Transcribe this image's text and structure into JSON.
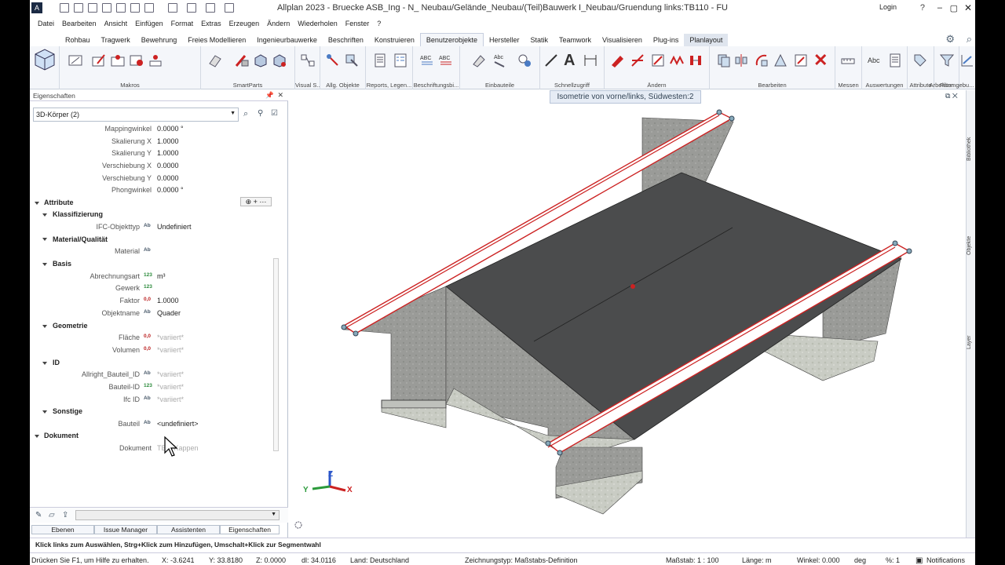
{
  "window": {
    "title": "Allplan 2023 - Bruecke ASB_Ing - N_ Neubau/Gelände_Neubau/(Teil)Bauwerk I_Neubau/Gruendung links:TB110 - FU",
    "login": "Login"
  },
  "menu": [
    "Datei",
    "Bearbeiten",
    "Ansicht",
    "Einfügen",
    "Format",
    "Extras",
    "Erzeugen",
    "Ändern",
    "Wiederholen",
    "Fenster",
    "?"
  ],
  "ribbon_tabs": [
    "Rohbau",
    "Tragwerk",
    "Bewehrung",
    "Freies Modellieren",
    "Ingenieurbauwerke",
    "Beschriften",
    "Konstruieren",
    "Benutzerobjekte",
    "Hersteller",
    "Statik",
    "Teamwork",
    "Visualisieren",
    "Plug-ins",
    "Planlayout"
  ],
  "ribbon_groups": [
    "Makros",
    "SmartParts",
    "Visual S...",
    "Allg. Objekte",
    "Reports, Legen...",
    "Beschriftungsbi...",
    "Einbauteile",
    "Schnellzugriff",
    "Ändern",
    "Bearbeiten",
    "Messen",
    "Auswertungen",
    "Attribute",
    "Filter",
    "Arbeitsumgebu..."
  ],
  "properties": {
    "header": "Eigenschaften",
    "selection": "3D-Körper (2)",
    "top_rows": [
      {
        "label": "Mappingwinkel",
        "value": "0.0000 °"
      },
      {
        "label": "Skalierung X",
        "value": "1.0000"
      },
      {
        "label": "Skalierung Y",
        "value": "1.0000"
      },
      {
        "label": "Verschiebung X",
        "value": "0.0000"
      },
      {
        "label": "Verschiebung Y",
        "value": "0.0000"
      },
      {
        "label": "Phongwinkel",
        "value": "0.0000 °"
      }
    ],
    "attribute_section": "Attribute",
    "sections": {
      "klassifizierung": "Klassifizierung",
      "material": "Material/Qualität",
      "basis": "Basis",
      "geometrie": "Geometrie",
      "id": "ID",
      "sonstige": "Sonstige",
      "dokument": "Dokument"
    },
    "rows": {
      "ifc": {
        "label": "IFC-Objekttyp",
        "badge": "Ab",
        "value": "Undefiniert"
      },
      "material": {
        "label": "Material",
        "badge": "Ab",
        "value": ""
      },
      "abrechnungsart": {
        "label": "Abrechnungsart",
        "badge": "123",
        "value": "m³"
      },
      "gewerk": {
        "label": "Gewerk",
        "badge": "123",
        "value": ""
      },
      "faktor": {
        "label": "Faktor",
        "badge": "0,0",
        "value": "1.0000"
      },
      "objektname": {
        "label": "Objektname",
        "badge": "Ab",
        "value": "Quader"
      },
      "flaeche": {
        "label": "Fläche",
        "badge": "0,0",
        "value": "*variiert*"
      },
      "volumen": {
        "label": "Volumen",
        "badge": "0,0",
        "value": "*variiert*"
      },
      "allright": {
        "label": "Allright_Bauteil_ID",
        "badge": "Ab",
        "value": "*variiert*"
      },
      "bauteilid": {
        "label": "Bauteil-ID",
        "badge": "123",
        "value": "*variiert*"
      },
      "ifcid": {
        "label": "Ifc ID",
        "badge": "Ab",
        "value": "*variiert*"
      },
      "bauteil": {
        "label": "Bauteil",
        "badge": "Ab",
        "value": "<undefiniert>"
      },
      "dokument": {
        "label": "Dokument",
        "value": "TB... Kappen"
      }
    }
  },
  "bottom_tabs": [
    "Ebenen",
    "Issue Manager",
    "Assistenten",
    "Eigenschaften"
  ],
  "viewport": {
    "title": "Isometrie von vorne/links, Südwesten:2",
    "axes": {
      "x": "X",
      "y": "Y",
      "z": "Z"
    }
  },
  "right_tabs": [
    "Bibliothek",
    "Objekte",
    "Layer"
  ],
  "hint": "Klick links zum Auswählen, Strg+Klick zum Hinzufügen, Umschalt+Klick zur Segmentwahl",
  "status": {
    "help": "Drücken Sie F1, um Hilfe zu erhalten.",
    "x": "X:  -3.6241",
    "y": "Y:  33.8180",
    "z": "Z:  0.0000",
    "dl": "dl:  34.0116",
    "land": "Land:  Deutschland",
    "zeichnungstyp": "Zeichnungstyp:  Maßstabs-Definition",
    "massstab": "Maßstab:  1 : 100",
    "laenge": "Länge:  m",
    "winkel": "Winkel:  0.000",
    "deg": "deg",
    "percent": "%:  1",
    "notifications": "Notifications"
  }
}
